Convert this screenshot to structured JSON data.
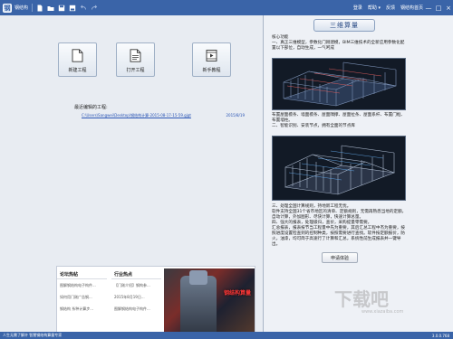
{
  "titlebar": {
    "app_title": "钢结构",
    "logo_glyph": "钢",
    "links": [
      "登录",
      "帮助 ▾",
      "反馈",
      "钢结构首页"
    ],
    "controls": [
      "—",
      "□",
      "×"
    ]
  },
  "actions": [
    {
      "label": "新建工程",
      "icon": "new-file-icon"
    },
    {
      "label": "打开工程",
      "icon": "open-file-icon"
    },
    {
      "label": "新手教程",
      "icon": "video-tutorial-icon"
    }
  ],
  "recent": {
    "title": "最近编辑的工程:",
    "items": [
      {
        "path": "C:\\Users\\Sangwei\\Desktop\\钢结构计算-2015-08-17-15-59.gjgt",
        "date": "2015/8/19"
      }
    ]
  },
  "news": {
    "col1_header": "论坛热帖",
    "col2_header": "行业热点",
    "col1_items": [
      "图解钢结构电子构件...",
      "如何用门刚广告钢...",
      "钢结构 系种计算步..."
    ],
    "col2_items": [
      "【门刚介绍】钢构参...",
      "2015年8月19日...",
      "图解钢结构电子构件..."
    ],
    "banner_text": "钢结构算量"
  },
  "right": {
    "headline": "三维算量",
    "p1": "核心功能\n一、真正三维模型，参数化门刚建模，BIM三维技术的全新应用参数化配置以下部位，自动生成，一气呵成",
    "p2": "布置屋面檩条、墙面檩条、屋面隅撑、屋面拉条、屋面系杆、布置门框、布置墙柱。\n二、智能识别、安装节点，拥有全面的节点库",
    "p3": "三、处理全国计算规则，持地新工程无忧。\n软件支持全国31个省市地区的清单、定额规则，无需再熟悉当地的定额，自动计算，外加图形、尽快计算，快速计算总量。\n四、强大的报表，处理级归，查价，采购提量零需要。\n汇总报表，报表按节当工程量中先为重要，其后汇总工程中杰为重要，按照进度设置检查到的控制种类，按照需要进行查找。软件按定额报价，防火，油漆，均可简于高速行了计算和汇总，系统性前生成报表并一键导出。",
    "trial_button": "申请体验"
  },
  "watermark": {
    "text": "下载吧",
    "sub": "www.xiazaiba.com"
  },
  "status": {
    "left": "人生无需了解许 智慧钢结构算量专家",
    "right": "3.0.0.768"
  }
}
